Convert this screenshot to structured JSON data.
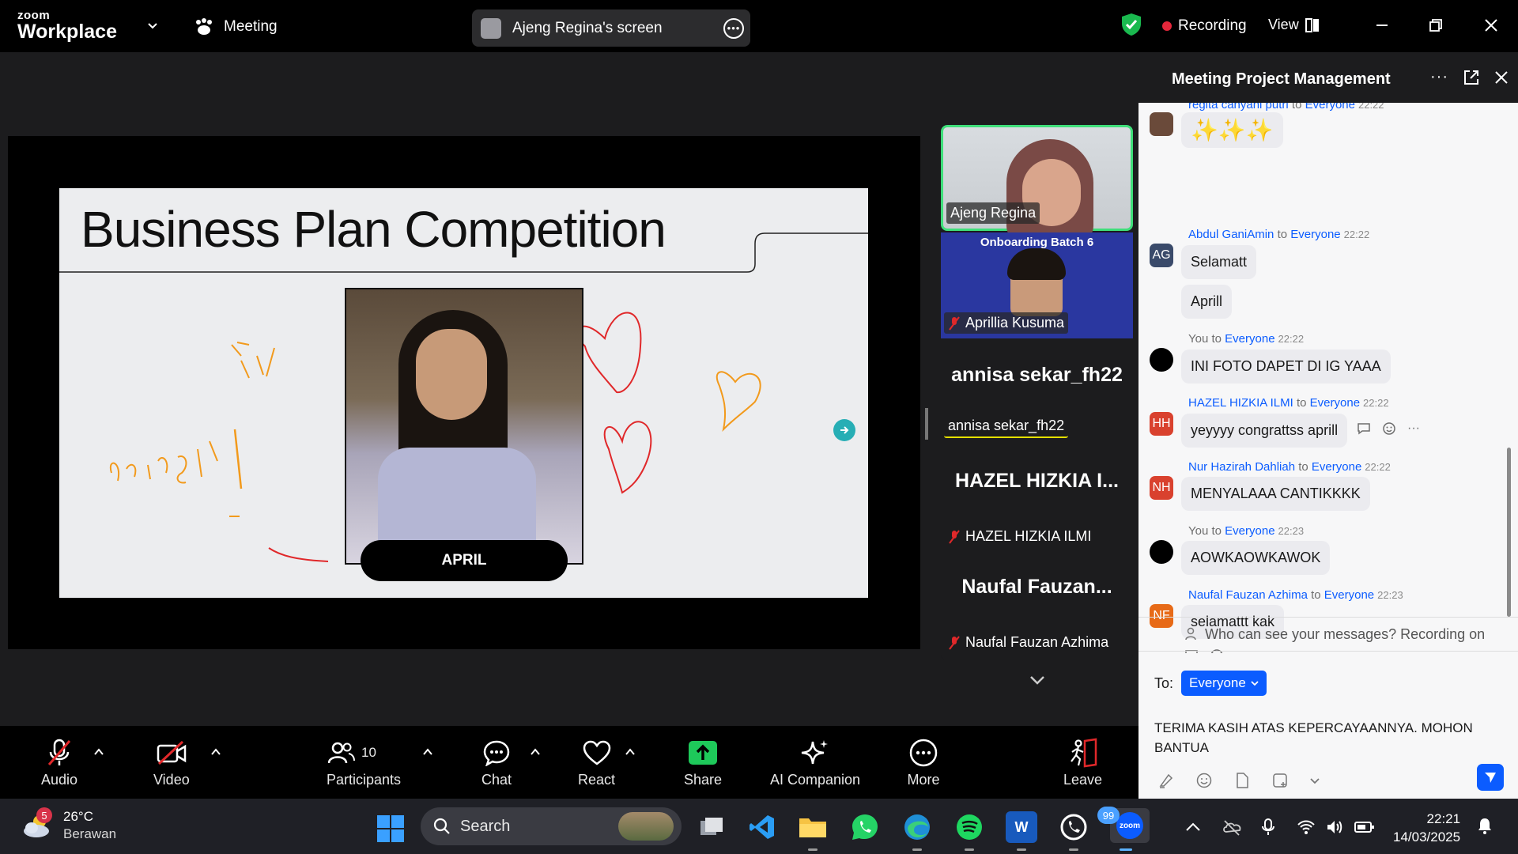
{
  "app": {
    "logo_line1": "zoom",
    "logo_line2": "Workplace",
    "meeting_label": "Meeting",
    "screen_share_label": "Ajeng Regina's screen",
    "recording_label": "Recording",
    "view_label": "View"
  },
  "slide": {
    "title": "Business Plan Competition",
    "name_label": "APRIL",
    "handwriting": "sviringt!"
  },
  "gallery": {
    "tiles": [
      {
        "name": "Ajeng Regina"
      },
      {
        "name": "Aprillia Kusuma",
        "banner": "Onboarding Batch 6"
      },
      {
        "big_name": "annisa sekar_fh22",
        "name": "annisa sekar_fh22"
      },
      {
        "big_name": "HAZEL HIZKIA I...",
        "name": "HAZEL HIZKIA ILMI"
      },
      {
        "big_name": "Naufal  Fauzan...",
        "name": "Naufal Fauzan Azhima"
      }
    ]
  },
  "chat": {
    "title": "Meeting Project Management",
    "messages": [
      {
        "sender": "regita cahyani putri",
        "to": "to",
        "recipient": "Everyone",
        "time": "22:22",
        "texts": [
          "✨✨✨"
        ]
      },
      {
        "sender": "Abdul GaniAmin",
        "to": "to",
        "recipient": "Everyone",
        "time": "22:22",
        "avatar": "AG",
        "texts": [
          "Selamatt",
          "Aprill"
        ]
      },
      {
        "sender": "You",
        "to": "to",
        "recipient": "Everyone",
        "time": "22:22",
        "texts": [
          "INI FOTO DAPET DI IG YAAA"
        ]
      },
      {
        "sender": "HAZEL HIZKIA ILMI",
        "to": "to",
        "recipient": "Everyone",
        "time": "22:22",
        "avatar": "HH",
        "texts": [
          "yeyyyy congrattss aprill"
        ]
      },
      {
        "sender": "Nur Hazirah Dahliah",
        "to": "to",
        "recipient": "Everyone",
        "time": "22:22",
        "avatar": "NH",
        "texts": [
          "MENYALAAA CANTIKKKK"
        ]
      },
      {
        "sender": "You",
        "to": "to",
        "recipient": "Everyone",
        "time": "22:23",
        "texts": [
          "AOWKAOWKAWOK"
        ]
      },
      {
        "sender": "Naufal Fauzan Azhima",
        "to": "to",
        "recipient": "Everyone",
        "time": "22:23",
        "avatar": "NF",
        "texts": [
          "selamattt kak"
        ]
      }
    ],
    "privacy_notice": "Who can see your messages? Recording on",
    "to_label": "To:",
    "to_value": "Everyone",
    "draft_text": "TERIMA KASIH ATAS KEPERCAYAANNYA. MOHON BANTUA",
    "colors": {
      "AG": "#3a4a6a",
      "HH": "#d9412e",
      "NH": "#d9412e",
      "NF": "#e76a17"
    }
  },
  "toolbar": {
    "audio": "Audio",
    "video": "Video",
    "participants": "Participants",
    "participants_count": "10",
    "chat": "Chat",
    "react": "React",
    "share": "Share",
    "ai_companion": "AI Companion",
    "more": "More",
    "leave": "Leave"
  },
  "taskbar": {
    "temperature": "26°C",
    "condition": "Berawan",
    "weather_badge": "5",
    "search_label": "Search",
    "whatsapp_badge": "99",
    "zoom_label": "zoom",
    "word_label": "W",
    "time": "22:21",
    "date": "14/03/2025"
  }
}
